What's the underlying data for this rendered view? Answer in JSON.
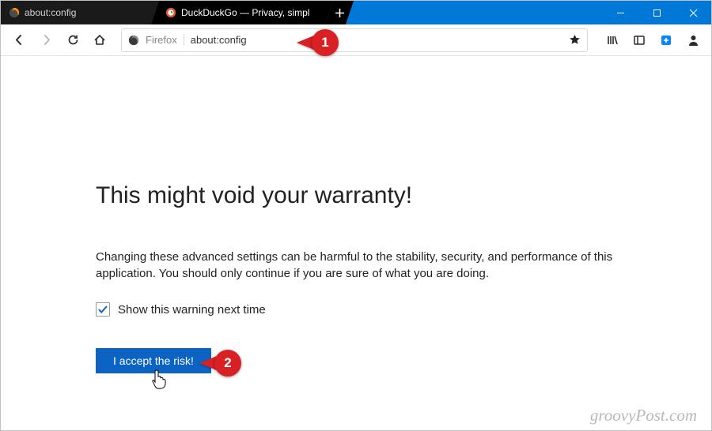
{
  "tabs": {
    "inactive": {
      "label": "about:config"
    },
    "active": {
      "label": "DuckDuckGo — Privacy, simpl"
    }
  },
  "address": {
    "identity": "Firefox",
    "url": "about:config"
  },
  "page": {
    "heading": "This might void your warranty!",
    "body": "Changing these advanced settings can be harmful to the stability, security, and performance of this application. You should only continue if you are sure of what you are doing.",
    "checkbox_label": "Show this warning next time",
    "accept_button": "I accept the risk!"
  },
  "callouts": {
    "one": "1",
    "two": "2"
  },
  "watermark": "groovyPost.com"
}
